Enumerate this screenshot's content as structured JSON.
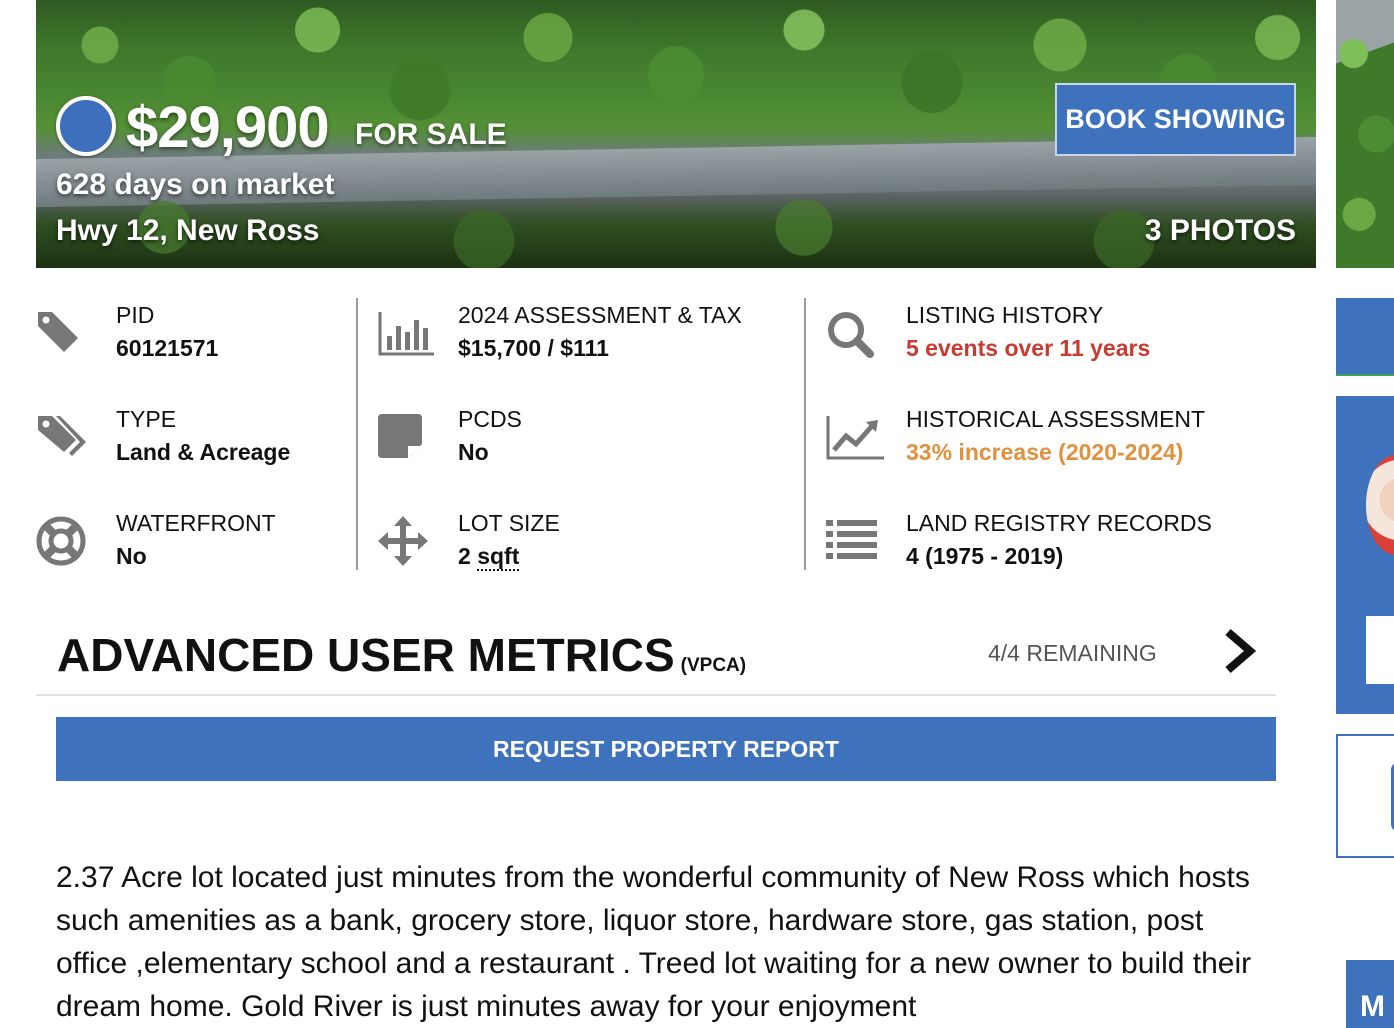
{
  "hero": {
    "price": "$29,900",
    "status": "FOR SALE",
    "days_on_market": "628 days on market",
    "address": "Hwy 12, New Ross",
    "book_label": "BOOK SHOWING",
    "photos_label": "3 PHOTOS"
  },
  "stats": {
    "pid": {
      "label": "PID",
      "value": "60121571"
    },
    "type": {
      "label": "TYPE",
      "value": "Land & Acreage"
    },
    "waterfront": {
      "label": "WATERFRONT",
      "value": "No"
    },
    "assessment": {
      "label": "2024 ASSESSMENT & TAX",
      "value": "$15,700 / $111"
    },
    "pcds": {
      "label": "PCDS",
      "value": "No"
    },
    "lot_size": {
      "label": "LOT SIZE",
      "value_num": "2",
      "value_unit": "sqft"
    },
    "listing_history": {
      "label": "LISTING HISTORY",
      "value": "5 events over 11 years"
    },
    "historical_assessment": {
      "label": "HISTORICAL ASSESSMENT",
      "value": "33% increase (2020-2024)"
    },
    "land_registry": {
      "label": "LAND REGISTRY RECORDS",
      "value": "4 (1975 - 2019)"
    }
  },
  "metrics": {
    "title": "ADVANCED USER METRICS",
    "subtitle": "(VPCA)",
    "remaining": "4/4 REMAINING",
    "report_button": "REQUEST PROPERTY REPORT"
  },
  "description": "2.37 Acre lot located just minutes from the wonderful community of New Ross which hosts such amenities as a bank, grocery store, liquor store, hardware store, gas station, post office ,elementary school and a restaurant . Treed lot waiting for a new owner to build their dream home. Gold River is just minutes away for your enjoyment",
  "sidebar": {
    "bottom_letter": "M"
  },
  "colors": {
    "accent": "#3f72bd",
    "history_red": "#c63c31",
    "assessment_orange": "#e0913f",
    "icon_gray": "#777777"
  }
}
